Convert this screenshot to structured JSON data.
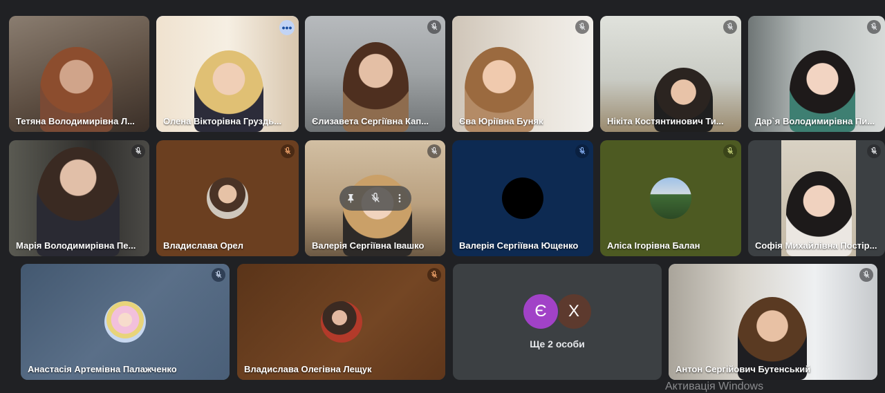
{
  "participants": [
    {
      "name": "Тетяна Володимирівна Л...",
      "mic": "none"
    },
    {
      "name": "Олена Вікторівна Груздь...",
      "mic": "more"
    },
    {
      "name": "Єлизавета Сергіївна Кап...",
      "mic": "muted"
    },
    {
      "name": "Єва Юріївна Буняк",
      "mic": "muted"
    },
    {
      "name": "Нікіта Костянтинович Ти...",
      "mic": "muted"
    },
    {
      "name": "Дар`я Володимирівна Пи...",
      "mic": "muted"
    },
    {
      "name": "Марія Володимирівна Пе...",
      "mic": "muted"
    },
    {
      "name": "Владислава Орел",
      "mic": "muted"
    },
    {
      "name": "Валерія Сергіївна Івашко",
      "mic": "muted"
    },
    {
      "name": "Валерія Сергіївна Ющенко",
      "mic": "muted"
    },
    {
      "name": "Аліса Ігорівна Балан",
      "mic": "muted"
    },
    {
      "name": "Софія Михайлівна Постір...",
      "mic": "muted"
    },
    {
      "name": "Анастасія Артемівна Палажченко",
      "mic": "muted"
    },
    {
      "name": "Владислава Олегівна Лещук",
      "mic": "muted"
    },
    {
      "name": "Антон Сергійович Бутенський",
      "mic": "muted"
    }
  ],
  "more_people": {
    "initials": [
      "Є",
      "Х"
    ],
    "label": "Ще 2 особи"
  },
  "watermark": "Активація Windows",
  "icons": {
    "muted": "mic-off-icon",
    "more": "more-options-icon",
    "pin": "pin-icon"
  },
  "colors": {
    "background": "#202124",
    "active_outline": "#8ab4f8",
    "tile_brown": "#6b3f20",
    "tile_navy": "#0d2a52",
    "tile_olive": "#4d5a22",
    "tile_slate": "#50647d",
    "tile_gray": "#3c4043",
    "circle_purple": "#a142c7",
    "circle_brown": "#5d3a2e"
  }
}
